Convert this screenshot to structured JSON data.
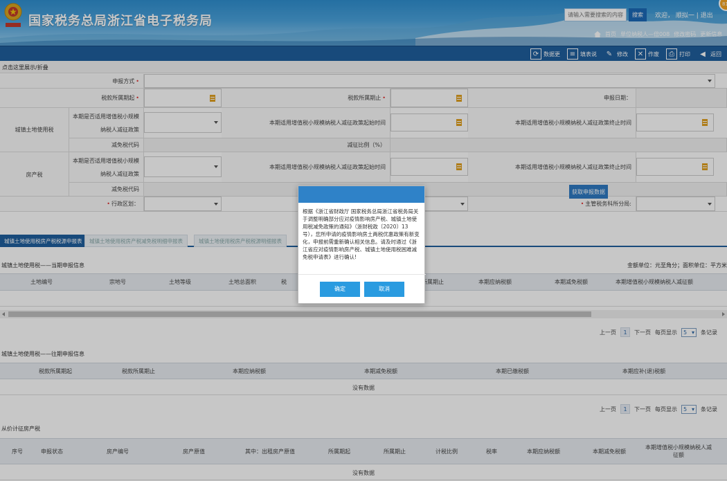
{
  "header": {
    "site_title": "国家税务总局浙江省电子税务局",
    "search_placeholder": "请输入需要搜索的内容",
    "search_button": "搜索",
    "welcome": "欢迎，  顺拟一  |  退出",
    "links": [
      "首页",
      "单位纳税人—倍008",
      "修改密码",
      "更新信息"
    ],
    "badge": "81"
  },
  "toolbar": {
    "items": [
      {
        "label": "数据更",
        "icon": "document-refresh-icon"
      },
      {
        "label": "填表说",
        "icon": "document-list-icon"
      },
      {
        "label": "修改",
        "icon": "pencil-icon"
      },
      {
        "label": "作废",
        "icon": "document-void-icon"
      },
      {
        "label": "打印",
        "icon": "printer-icon"
      },
      {
        "label": "返回",
        "icon": "back-arrow-icon"
      }
    ]
  },
  "collapse_text": "点击这里展示/折叠",
  "form": {
    "report_method": "申报方式",
    "period_start": "税款所属期起",
    "period_end": "税款所属期止",
    "report_date": "申报日期：",
    "land_tax": "城镇土地使用税",
    "property_tax": "房产税",
    "q_policy": "本期是否适用增值税小规模纳税人减征政策",
    "policy_start": "本期适用增值税小规模纳税人减征政策起始时间",
    "policy_end": "本期适用增值税小规模纳税人减征政策终止时间",
    "exempt_code": "减免税代码",
    "reduce_ratio": "减征比例（%）",
    "district": "行政区划：",
    "tax_branch": "主管税务科所分局:",
    "fetch_button": "获取申报数据"
  },
  "tabs": [
    "城镇土地使用税房产税税源申报表",
    "城镇土地使用税房产税减免税明细申报表",
    "城镇土地使用税房产税税源明细报表"
  ],
  "section1": {
    "title": "城镇土地使用税——当期申报信息",
    "unit_note": "金额单位：元至角分；面积单位：平方米",
    "columns": [
      "土地编号",
      "宗地号",
      "土地等级",
      "土地总面积",
      "税",
      "所属期止",
      "本期应纳税额",
      "本期减免税额",
      "本期增值税小规模纳税人减征额"
    ],
    "nodata": "没有数据"
  },
  "pager": {
    "prev": "上一页",
    "page": "1",
    "next": "下一页",
    "per_page_prefix": "每页显示",
    "per_page": "5",
    "suffix": "条记录"
  },
  "section2": {
    "title": "城镇土地使用税——往期申报信息",
    "columns": [
      "税款所属期起",
      "税款所属期止",
      "本期应纳税额",
      "本期减免税额",
      "本期已缴税额",
      "本期应补(退)税额"
    ],
    "nodata": "没有数据"
  },
  "section3": {
    "title": "从价计征房产税",
    "columns": [
      "序号",
      "申报状态",
      "房产编号",
      "房产原值",
      "其中：出租房产原值",
      "所属期起",
      "所属期止",
      "计税比例",
      "税率",
      "本期应纳税额",
      "本期减免税额",
      "本期增值税小规模纳税人减征额"
    ],
    "nodata": "没有数据"
  },
  "modal": {
    "body": "根据《浙江省财政厅 国家税务总局浙江省税务局关于调整明确部分应对疫情影响房产税、城镇土地使用税减免政策的通知》（浙财税政〔2020〕13号），您所申请的疫情影响房土两税优惠政策有新变化，申报前需重新确认相关信息。请及时通过《浙江省应对疫情影响房产税、城镇土地使用税困难减免税申请表》进行确认!",
    "confirm": "确定",
    "cancel": "取消"
  }
}
